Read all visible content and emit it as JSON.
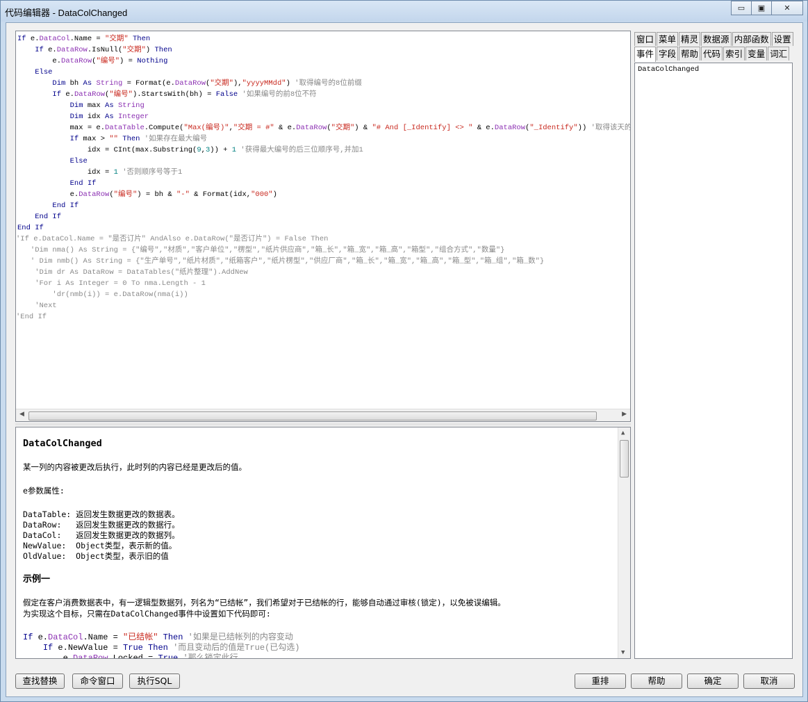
{
  "window": {
    "title": "代码编辑器 - DataColChanged",
    "buttons": {
      "minimize": "▭",
      "maximize": "▣",
      "close": "✕"
    }
  },
  "tabs": {
    "row1": [
      "窗口",
      "菜单",
      "精灵",
      "数据源",
      "内部函数",
      "设置"
    ],
    "row2": [
      "事件",
      "字段",
      "帮助",
      "代码",
      "索引",
      "变量",
      "词汇"
    ],
    "active": "事件"
  },
  "event_list": [
    "DataColChanged"
  ],
  "help": {
    "title": "DataColChanged",
    "desc": "某一列的内容被更改后执行，此时列的内容已经是更改后的值。",
    "params_heading": "e参数属性:",
    "params": [
      "DataTable: 返回发生数据更改的数据表。",
      "DataRow:   返回发生数据更改的数据行。",
      "DataCol:   返回发生数据更改的数据列。",
      "NewValue:  Object类型，表示新的值。",
      "OldValue:  Object类型，表示旧的值"
    ],
    "example_heading": "示例一",
    "example_p1": "假定在客户消费数据表中，有一逻辑型数据列，列名为“已结帐”，我们希望对于已结帐的行，能够自动通过审核(锁定)，以免被误编辑。",
    "example_p2": "为实现这个目标，只需在DataColChanged事件中设置如下代码即可:"
  },
  "buttons": {
    "find_replace": "查找替换",
    "command_window": "命令窗口",
    "execute_sql": "执行SQL",
    "rearrange": "重排",
    "help": "帮助",
    "ok": "确定",
    "cancel": "取消"
  }
}
